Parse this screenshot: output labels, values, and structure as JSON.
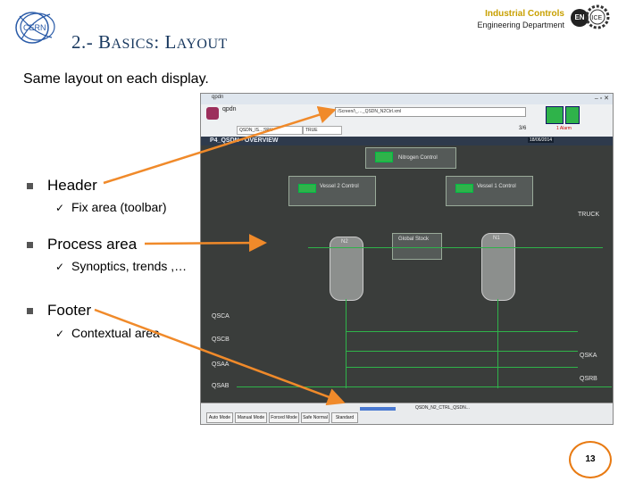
{
  "slide": {
    "title_prefix": "2.- B",
    "title_small1": "ASICS",
    "title_sep": ": L",
    "title_small2": "AYOUT",
    "subtitle": "Same layout on each display.",
    "header_right_line1": "Industrial Controls",
    "header_right_line2": "Engineering Department",
    "en_badge": "EN",
    "page_number": "13"
  },
  "bullets": [
    {
      "label": "Header",
      "sub": "Fix area (toolbar)"
    },
    {
      "label": "Process area",
      "sub": "Synoptics, trends ,…"
    },
    {
      "label": "Footer",
      "sub": "Contextual area"
    }
  ],
  "screenshot": {
    "window_title": "qpdn",
    "toolbar_path": "/Screen/\\_…_QSDN_N2Ctrl.xml",
    "toolbar_field1": "QSDN_IS…SPH",
    "toolbar_field2": "TRUE",
    "toolbar_count": "3/6",
    "toolbar_alarm": "1 Alarm",
    "nav_title": "P4_QSDN - OVERVIEW",
    "nav_date": "18/06/2014",
    "panel_nitrogen": "Nitrogen Control",
    "panel_vessel2": "Vessel 2 Control",
    "panel_vessel1": "Vessel 1 Control",
    "panel_global": "Global Stock",
    "vessel_left": "N2",
    "vessel_right": "N1",
    "right_label_truck": "TRUCK",
    "right_label_qska": "QSKA",
    "right_label_qsrb": "QSRB",
    "left_labels": [
      "QSCA",
      "QSCB",
      "QSAA",
      "QSAB"
    ],
    "footer_tabs": [
      "Auto Mode",
      "Manual Mode",
      "Forced Mode",
      "Safe Normal",
      "Standard"
    ],
    "footer_text": "QSDN_N2_CTRL_QSDN..."
  },
  "colors": {
    "title": "#17375e",
    "accent_orange": "#e87a12",
    "arrow": "#f08a2a",
    "process_green": "#2fb34a",
    "process_bg": "#3a3d3b"
  }
}
